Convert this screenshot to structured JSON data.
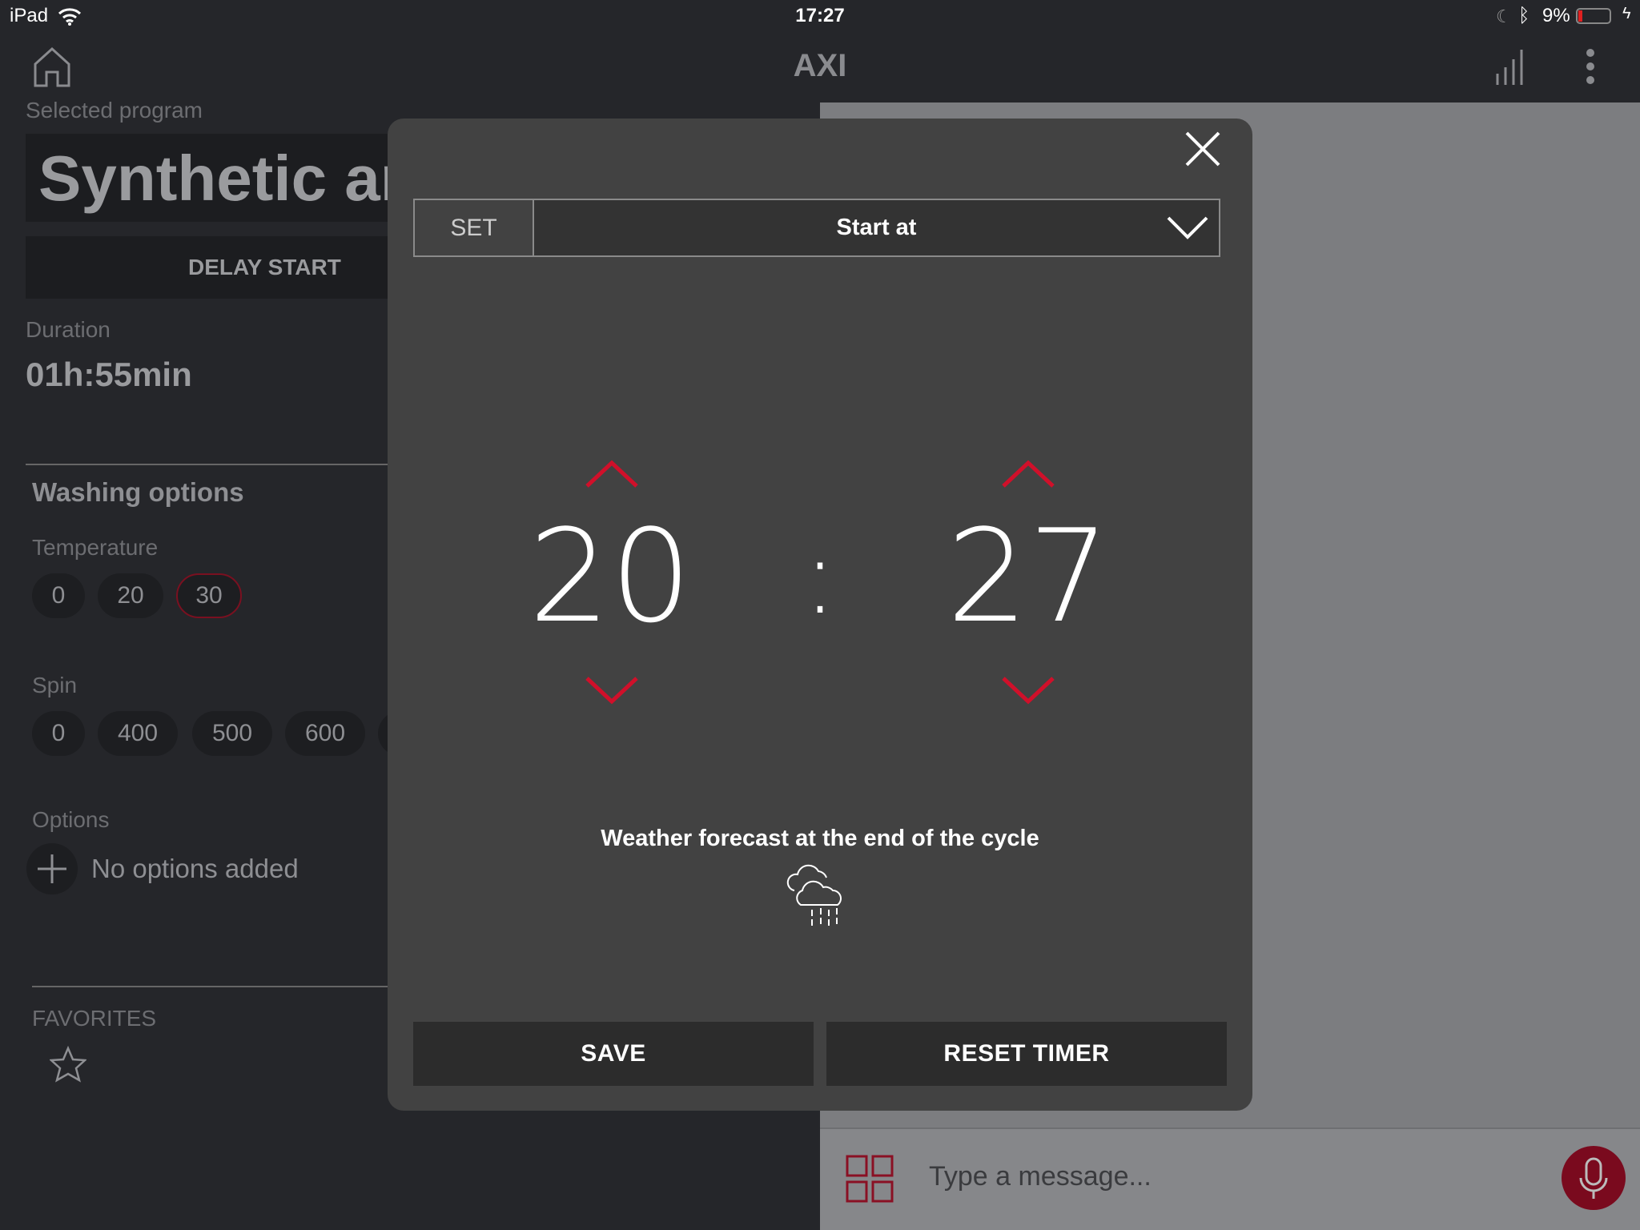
{
  "status_bar": {
    "device": "iPad",
    "time": "17:27",
    "battery": "9%"
  },
  "header": {
    "title": "AXI",
    "icons": [
      "home-icon",
      "signal-bars-icon",
      "more-vertical-icon"
    ]
  },
  "left": {
    "selected_program_label": "Selected program",
    "program_name": "Synthetic an",
    "delay_start": "DELAY START",
    "duration_label": "Duration",
    "duration_value": "01h:55min",
    "washing_options": "Washing options",
    "temperature_label": "Temperature",
    "temperatures": [
      "0",
      "20",
      "30"
    ],
    "selected_temperature": "30",
    "spin_label": "Spin",
    "spins": [
      "0",
      "400",
      "500",
      "600"
    ],
    "options_label": "Options",
    "no_options": "No options added",
    "favorites": "FAVORITES"
  },
  "modal": {
    "set_label": "SET",
    "mode_value": "Start at",
    "hours": "20",
    "separator": ":",
    "minutes": "27",
    "weather_label": "Weather forecast at the end of the cycle",
    "weather_icon": "cloud-rain-icon",
    "save": "SAVE",
    "reset": "RESET TIMER"
  },
  "chat": {
    "placeholder": "Type a message..."
  },
  "colors": {
    "accent": "#d0102a",
    "mic": "#7a0a1e",
    "modal_bg": "#424242",
    "panel_bg": "#7c7d80"
  }
}
